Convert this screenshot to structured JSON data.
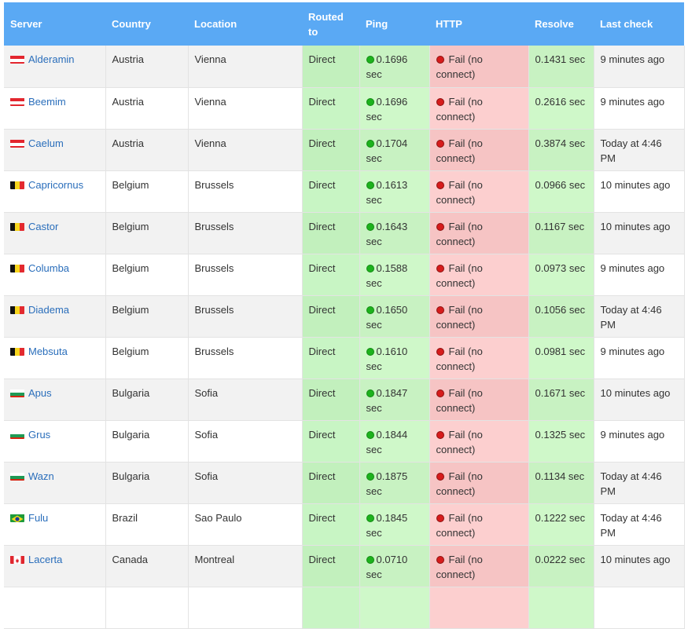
{
  "headers": {
    "server": "Server",
    "country": "Country",
    "location": "Location",
    "routed_line1": "Routed",
    "routed_line2": "to",
    "ping": "Ping",
    "http": "HTTP",
    "resolve": "Resolve",
    "last_check": "Last check"
  },
  "status_text": {
    "ping_unit": "sec",
    "http_fail_line1": "Fail (no",
    "http_fail_line2": "connect)"
  },
  "colors": {
    "header_bg": "#5aa9f4",
    "ok_green": "#1db21d",
    "fail_red": "#d61c1c",
    "link_blue": "#2a6ebb"
  },
  "rows": [
    {
      "flag": "austria-flag",
      "server": "Alderamin",
      "country": "Austria",
      "location": "Vienna",
      "routed": "Direct",
      "ping": "0.1696",
      "resolve": "0.1431 sec",
      "last1": "9 minutes ago",
      "last2": ""
    },
    {
      "flag": "austria-flag",
      "server": "Beemim",
      "country": "Austria",
      "location": "Vienna",
      "routed": "Direct",
      "ping": "0.1696",
      "resolve": "0.2616 sec",
      "last1": "9 minutes ago",
      "last2": ""
    },
    {
      "flag": "austria-flag",
      "server": "Caelum",
      "country": "Austria",
      "location": "Vienna",
      "routed": "Direct",
      "ping": "0.1704",
      "resolve": "0.3874 sec",
      "last1": "Today at 4:46",
      "last2": "PM"
    },
    {
      "flag": "belgium-flag",
      "server": "Capricornus",
      "country": "Belgium",
      "location": "Brussels",
      "routed": "Direct",
      "ping": "0.1613",
      "resolve": "0.0966 sec",
      "last1": "10 minutes ago",
      "last2": ""
    },
    {
      "flag": "belgium-flag",
      "server": "Castor",
      "country": "Belgium",
      "location": "Brussels",
      "routed": "Direct",
      "ping": "0.1643",
      "resolve": "0.1167 sec",
      "last1": "10 minutes ago",
      "last2": ""
    },
    {
      "flag": "belgium-flag",
      "server": "Columba",
      "country": "Belgium",
      "location": "Brussels",
      "routed": "Direct",
      "ping": "0.1588",
      "resolve": "0.0973 sec",
      "last1": "9 minutes ago",
      "last2": ""
    },
    {
      "flag": "belgium-flag",
      "server": "Diadema",
      "country": "Belgium",
      "location": "Brussels",
      "routed": "Direct",
      "ping": "0.1650",
      "resolve": "0.1056 sec",
      "last1": "Today at 4:46",
      "last2": "PM"
    },
    {
      "flag": "belgium-flag",
      "server": "Mebsuta",
      "country": "Belgium",
      "location": "Brussels",
      "routed": "Direct",
      "ping": "0.1610",
      "resolve": "0.0981 sec",
      "last1": "9 minutes ago",
      "last2": ""
    },
    {
      "flag": "bulgaria-flag",
      "server": "Apus",
      "country": "Bulgaria",
      "location": "Sofia",
      "routed": "Direct",
      "ping": "0.1847",
      "resolve": "0.1671 sec",
      "last1": "10 minutes ago",
      "last2": ""
    },
    {
      "flag": "bulgaria-flag",
      "server": "Grus",
      "country": "Bulgaria",
      "location": "Sofia",
      "routed": "Direct",
      "ping": "0.1844",
      "resolve": "0.1325 sec",
      "last1": "9 minutes ago",
      "last2": ""
    },
    {
      "flag": "bulgaria-flag",
      "server": "Wazn",
      "country": "Bulgaria",
      "location": "Sofia",
      "routed": "Direct",
      "ping": "0.1875",
      "resolve": "0.1134 sec",
      "last1": "Today at 4:46",
      "last2": "PM"
    },
    {
      "flag": "brazil-flag",
      "server": "Fulu",
      "country": "Brazil",
      "location": "Sao Paulo",
      "routed": "Direct",
      "ping": "0.1845",
      "resolve": "0.1222 sec",
      "last1": "Today at 4:46",
      "last2": "PM"
    },
    {
      "flag": "canada-flag",
      "server": "Lacerta",
      "country": "Canada",
      "location": "Montreal",
      "routed": "Direct",
      "ping": "0.0710",
      "resolve": "0.0222 sec",
      "last1": "10 minutes ago",
      "last2": ""
    },
    {
      "flag": "",
      "server": "",
      "country": "",
      "location": "",
      "routed": "",
      "ping": "",
      "resolve": "",
      "last1": "",
      "last2": ""
    }
  ]
}
